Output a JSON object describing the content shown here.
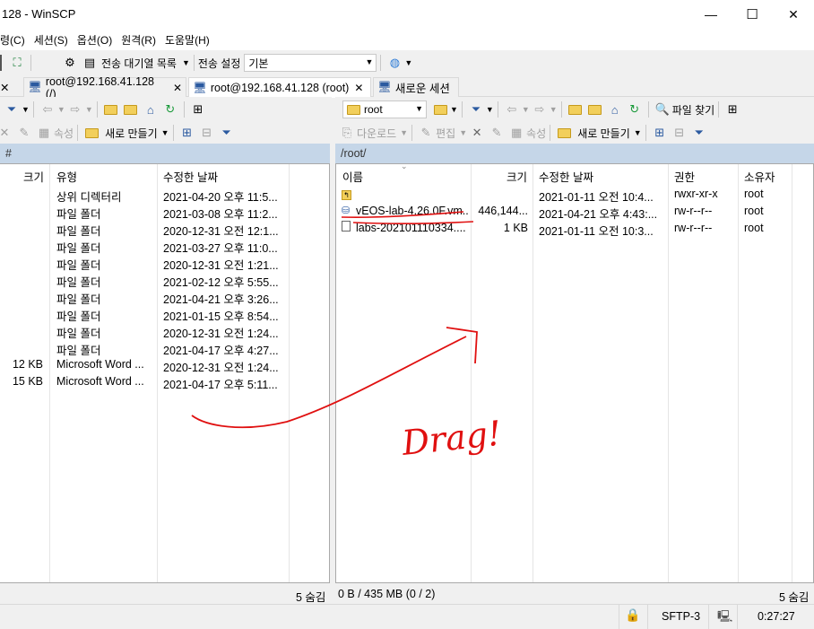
{
  "window": {
    "title": "128 - WinSCP",
    "minimize": "—",
    "maximize": "☐",
    "close": "✕"
  },
  "menu": [
    "령(C)",
    "세션(S)",
    "옵션(O)",
    "원격(R)",
    "도움말(H)"
  ],
  "toolbar1": {
    "queue_label": "전송 대기열 목록",
    "transfer_settings_label": "전송 설정",
    "transfer_preset": "기본"
  },
  "tabs": [
    {
      "label": "root@192.168.41.128 (/)",
      "close": "✕"
    },
    {
      "label": "root@192.168.41.128 (root)",
      "close": "✕"
    },
    {
      "label": "새로운 세션"
    }
  ],
  "left_panel": {
    "properties_label": "속성",
    "new_label": "새로 만들기",
    "path": "#",
    "columns": {
      "size": "크기",
      "type": "유형",
      "modified": "수정한 날짜"
    },
    "rows": [
      {
        "size": "",
        "type": "상위 디렉터리",
        "modified": "2021-04-20  오후 11:5..."
      },
      {
        "size": "",
        "type": "파일 폴더",
        "modified": "2021-03-08  오후 11:2..."
      },
      {
        "size": "",
        "type": "파일 폴더",
        "modified": "2020-12-31  오전 12:1..."
      },
      {
        "size": "",
        "type": "파일 폴더",
        "modified": "2021-03-27  오후 11:0..."
      },
      {
        "size": "",
        "type": "파일 폴더",
        "modified": "2020-12-31  오전 1:21..."
      },
      {
        "size": "",
        "type": "파일 폴더",
        "modified": "2021-02-12  오후 5:55..."
      },
      {
        "size": "",
        "type": "파일 폴더",
        "modified": "2021-04-21  오후 3:26..."
      },
      {
        "size": "",
        "type": "파일 폴더",
        "modified": "2021-01-15  오후 8:54..."
      },
      {
        "size": "",
        "type": "파일 폴더",
        "modified": "2020-12-31  오전 1:24..."
      },
      {
        "size": "",
        "type": "파일 폴더",
        "modified": "2021-04-17  오후 4:27..."
      },
      {
        "size": "12 KB",
        "type": "Microsoft Word ...",
        "modified": "2020-12-31  오전 1:24..."
      },
      {
        "size": "15 KB",
        "type": "Microsoft Word ...",
        "modified": "2021-04-17  오후 5:11..."
      }
    ],
    "status": "5 숨김"
  },
  "right_panel": {
    "dir_select": "root",
    "find_files_label": "파일 찾기",
    "download_label": "다운로드",
    "edit_label": "편집",
    "properties_label": "속성",
    "new_label": "새로 만들기",
    "path": "/root/",
    "columns": {
      "name": "이름",
      "size": "크기",
      "modified": "수정한 날짜",
      "rights": "권한",
      "owner": "소유자"
    },
    "rows": [
      {
        "name": "",
        "size": "",
        "modified": "2021-01-11  오전 10:4...",
        "rights": "rwxr-xr-x",
        "owner": "root"
      },
      {
        "name": "vEOS-lab-4.26.0F.vm...",
        "size": "446,144...",
        "modified": "2021-04-21  오후 4:43:...",
        "rights": "rw-r--r--",
        "owner": "root"
      },
      {
        "name": "labs-202101110334....",
        "size": "1 KB",
        "modified": "2021-01-11  오전 10:3...",
        "rights": "rw-r--r--",
        "owner": "root"
      }
    ],
    "status_left": "0 B / 435 MB (0 / 2)",
    "status_right": "5 숨김"
  },
  "statusbar": {
    "protocol": "SFTP-3",
    "timer": "0:27:27"
  },
  "annotation": {
    "text": "Drag!",
    "color": "#e01010"
  }
}
